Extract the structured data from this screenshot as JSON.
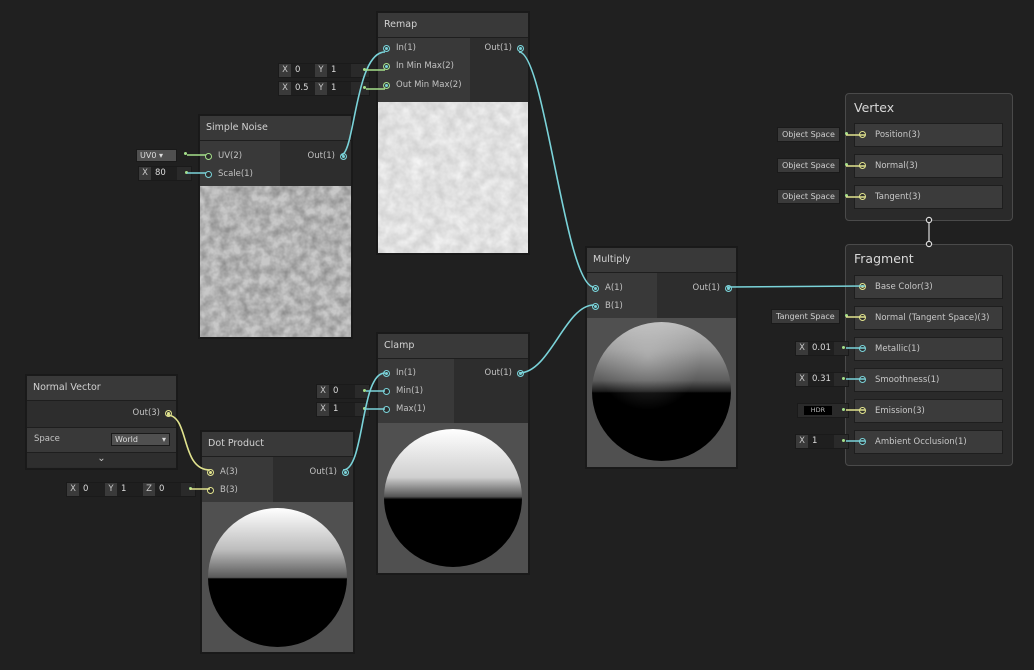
{
  "remap": {
    "title": "Remap",
    "in1": "In(1)",
    "in_min_max": "In Min Max(2)",
    "out_min_max": "Out Min Max(2)",
    "out": "Out(1)",
    "in_min_x": "0",
    "in_min_y": "1",
    "out_min_x": "0.5",
    "out_min_y": "1"
  },
  "simple_noise": {
    "title": "Simple Noise",
    "uv": "UV(2)",
    "scale": "Scale(1)",
    "out": "Out(1)",
    "uv_value": "UV0",
    "scale_value": "80"
  },
  "multiply": {
    "title": "Multiply",
    "a": "A(1)",
    "b": "B(1)",
    "out": "Out(1)"
  },
  "clamp": {
    "title": "Clamp",
    "in1": "In(1)",
    "min": "Min(1)",
    "max": "Max(1)",
    "out": "Out(1)",
    "min_value": "0",
    "max_value": "1"
  },
  "normal_vector": {
    "title": "Normal Vector",
    "out": "Out(3)",
    "space_label": "Space",
    "space_value": "World"
  },
  "dot_product": {
    "title": "Dot Product",
    "a": "A(3)",
    "b": "B(3)",
    "out": "Out(1)",
    "b_x": "0",
    "b_y": "1",
    "b_z": "0"
  },
  "axis": {
    "x": "X",
    "y": "Y",
    "z": "Z"
  },
  "vertex": {
    "title": "Vertex",
    "ports": [
      "Position(3)",
      "Normal(3)",
      "Tangent(3)"
    ],
    "space": "Object Space"
  },
  "fragment": {
    "title": "Fragment",
    "ports": [
      "Base Color(3)",
      "Normal (Tangent Space)(3)",
      "Metallic(1)",
      "Smoothness(1)",
      "Emission(3)",
      "Ambient Occlusion(1)"
    ],
    "normal_space": "Tangent Space",
    "metallic": "0.01",
    "smoothness": "0.31",
    "emission": "HDR",
    "ao": "1"
  },
  "colors": {
    "wire": "#7ad3d9",
    "wire_vec3": "#e1e38e",
    "background": "#202020"
  }
}
